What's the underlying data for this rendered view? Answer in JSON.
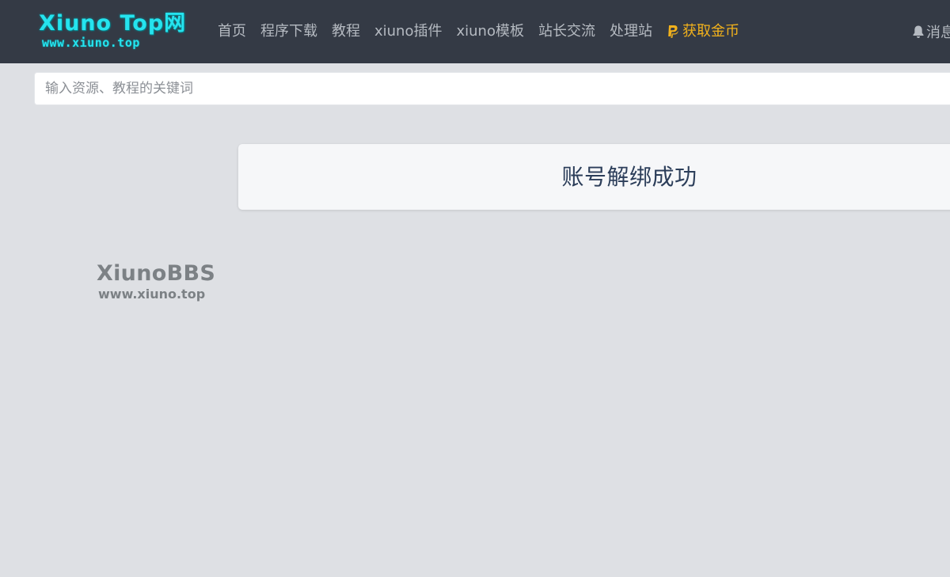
{
  "header": {
    "logo_main": "Xiuno Top网",
    "logo_sub": "www.xiuno.top",
    "nav": [
      {
        "label": "首页"
      },
      {
        "label": "程序下载"
      },
      {
        "label": "教程"
      },
      {
        "label": "xiuno插件"
      },
      {
        "label": "xiuno模板"
      },
      {
        "label": "站长交流"
      },
      {
        "label": "处理站"
      }
    ],
    "coins": {
      "label": "获取金币",
      "icon": "paypal-icon",
      "color": "#f1b11c"
    },
    "messages": {
      "label": "消息",
      "icon": "bell-icon"
    }
  },
  "search": {
    "placeholder": "输入资源、教程的关键词",
    "value": ""
  },
  "watermark": {
    "main": "XiunoBBS",
    "sub": "www.xiuno.top"
  },
  "message": {
    "text": "账号解绑成功"
  },
  "colors": {
    "navbar_bg": "#343a45",
    "page_bg": "#dee0e4",
    "logo_cyan": "#25e3ee",
    "accent_gold": "#f1b11c",
    "message_text": "#2c3e5a"
  }
}
